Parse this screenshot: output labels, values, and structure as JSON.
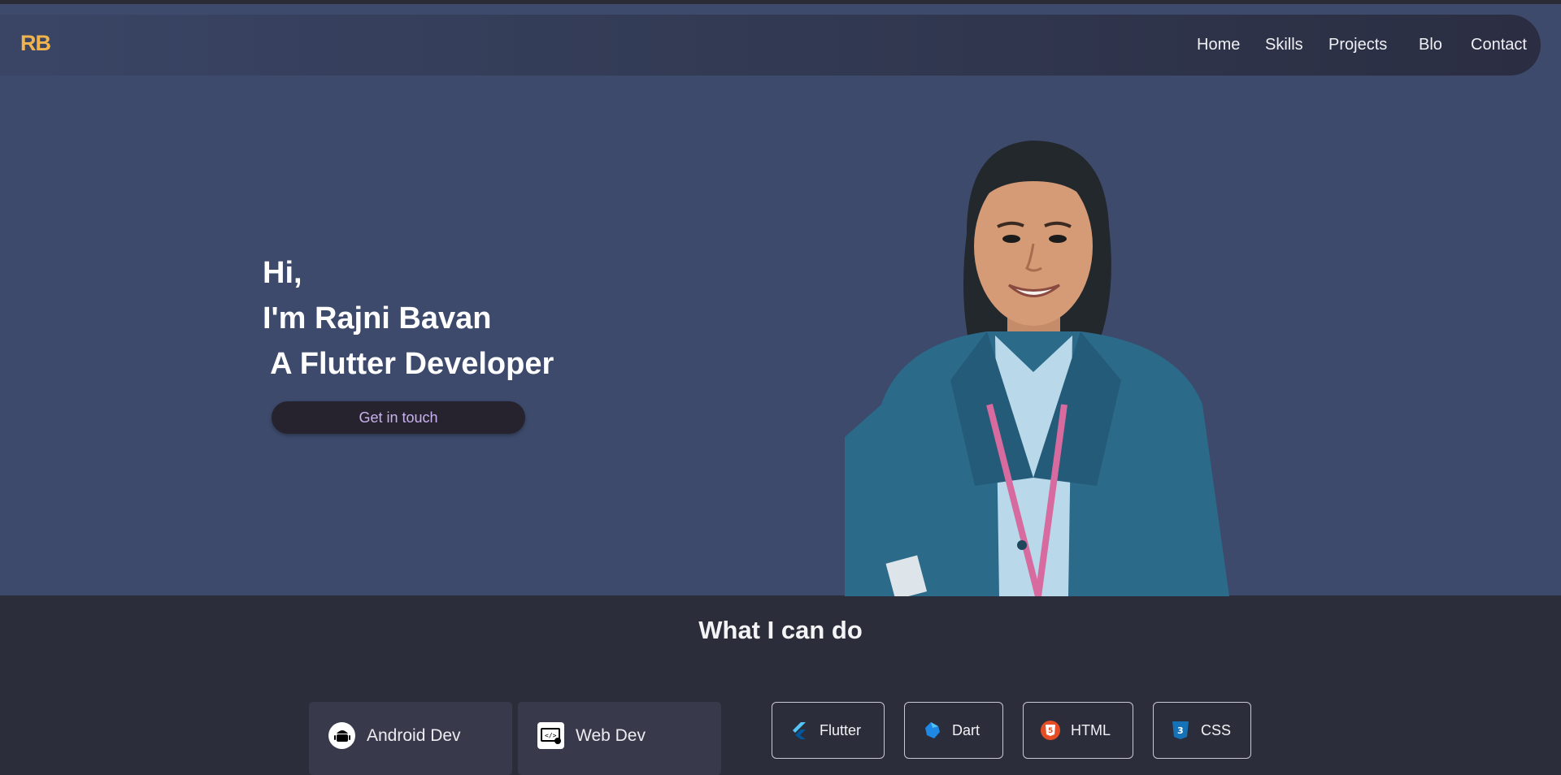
{
  "brand": {
    "logo": "RB"
  },
  "nav": {
    "home": "Home",
    "skills": "Skills",
    "projects": "Projects",
    "blog": "Blo",
    "contact": "Contact"
  },
  "hero": {
    "line1": "Hi,",
    "line2": "I'm Rajni Bavan",
    "line3": " A Flutter Developer",
    "cta": "Get in touch"
  },
  "skills": {
    "title": "What I can do",
    "cards": [
      {
        "label": "Android Dev",
        "icon": "android-icon"
      },
      {
        "label": "Web Dev",
        "icon": "web-dev-icon"
      }
    ],
    "chips": [
      {
        "label": "Flutter",
        "icon": "flutter-icon"
      },
      {
        "label": "Dart",
        "icon": "dart-icon"
      },
      {
        "label": "HTML",
        "icon": "html5-icon"
      },
      {
        "label": "CSS",
        "icon": "css3-icon"
      }
    ]
  },
  "colors": {
    "hero_bg": "#3d4a6b",
    "page_bg": "#2c2d3a",
    "logo": "#f1b44c",
    "cta_text": "#c9b1f1"
  }
}
